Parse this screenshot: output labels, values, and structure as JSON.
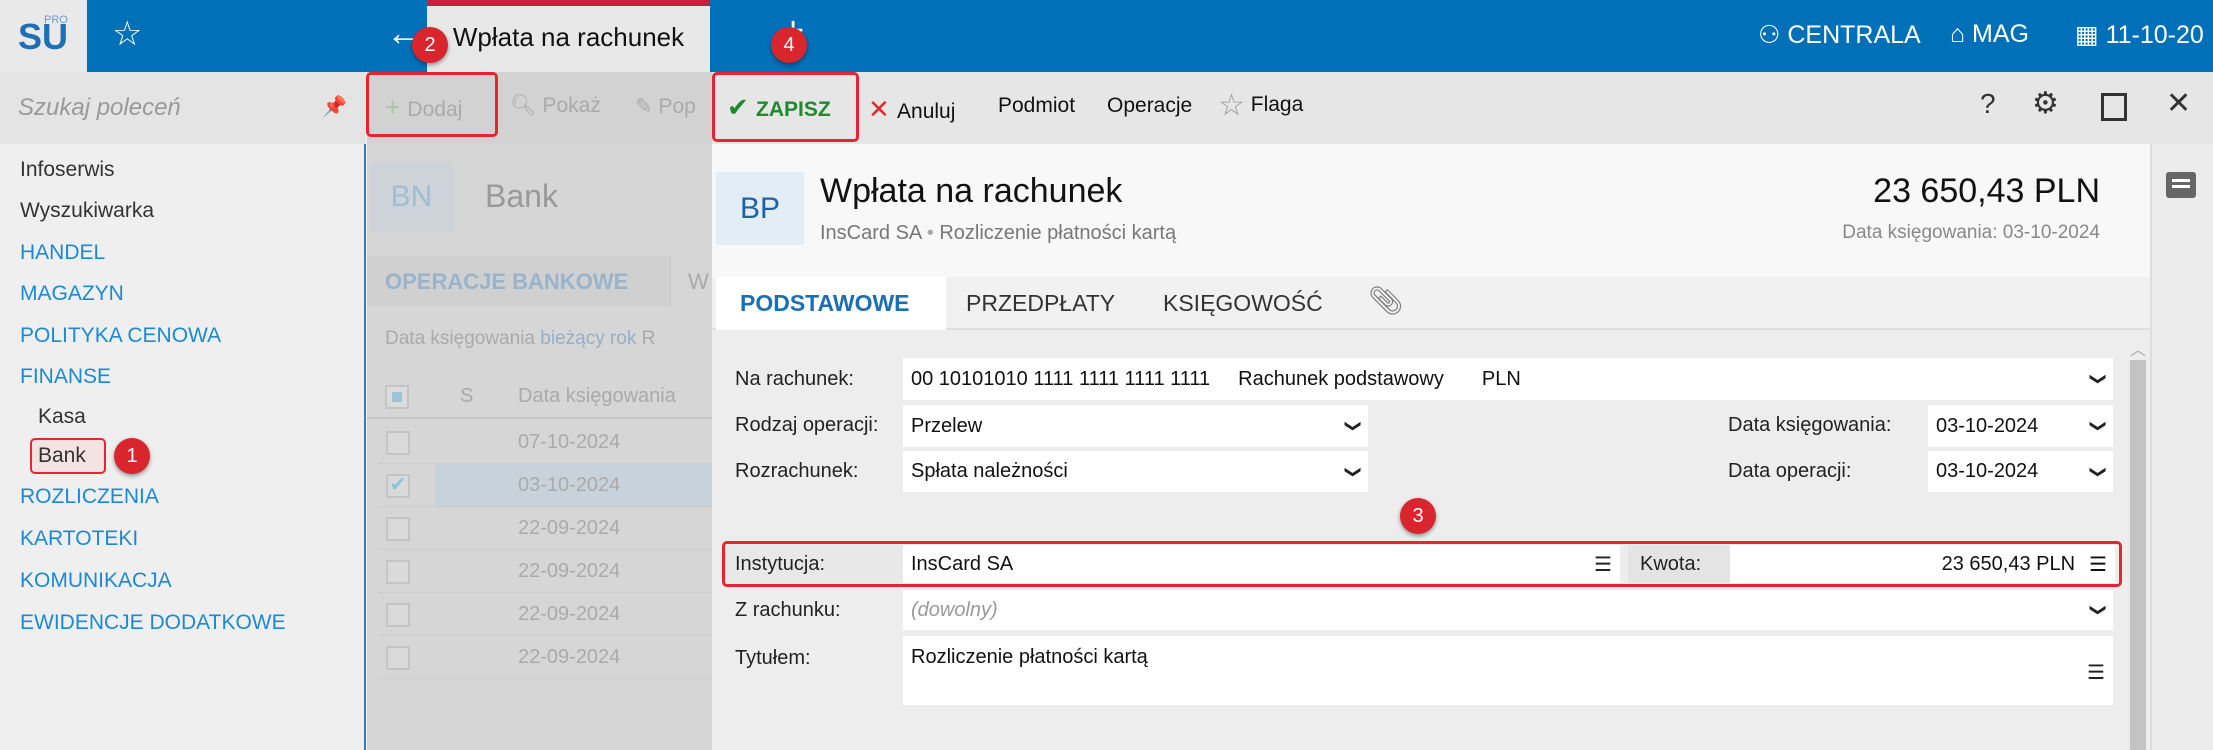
{
  "header": {
    "logo": "SU",
    "logo_sup": "PRO",
    "tab_title": "Wpłata na rachunek",
    "branch": "CENTRALA",
    "warehouse": "MAG",
    "date": "11-10-20"
  },
  "sidebar": {
    "search_placeholder": "Szukaj poleceń",
    "items": [
      "Infoserwis",
      "Wyszukiwarka",
      "HANDEL",
      "MAGAZYN",
      "POLITYKA CENOWA",
      "FINANSE",
      "Kasa",
      "Bank",
      "ROZLICZENIA",
      "KARTOTEKI",
      "KOMUNIKACJA",
      "EWIDENCJE DODATKOWE"
    ]
  },
  "middle": {
    "toolbar": [
      "Dodaj",
      "Pokaż",
      "Pop"
    ],
    "badge": "BN",
    "title": "Bank",
    "tab": "OPERACJE BANKOWE",
    "tab2": "W",
    "filter_label": "Data księgowania",
    "filter_value": "bieżący rok",
    "filter_more": "R",
    "col_s": "S",
    "col_date": "Data księgowania",
    "rows": [
      "07-10-2024",
      "03-10-2024",
      "22-09-2024",
      "22-09-2024",
      "22-09-2024",
      "22-09-2024"
    ]
  },
  "dialog": {
    "toolbar": {
      "save": "ZAPISZ",
      "cancel": "Anuluj",
      "subject": "Podmiot",
      "operations": "Operacje",
      "flag": "Flaga"
    },
    "badge": "BP",
    "title": "Wpłata na rachunek",
    "subject": "InsCard SA",
    "sep": "•",
    "subtitle": "Rozliczenie płatności kartą",
    "amount": "23 650,43 PLN",
    "posting_date_text": "Data księgowania: 03-10-2024",
    "tabs": [
      "PODSTAWOWE",
      "PRZEDPŁATY",
      "KSIĘGOWOŚĆ"
    ],
    "form": {
      "account_label": "Na rachunek:",
      "account_number": "00 10101010 1111 1111 1111 1111",
      "account_name": "Rachunek podstawowy",
      "account_currency": "PLN",
      "op_type_label": "Rodzaj operacji:",
      "op_type": "Przelew",
      "settlement_label": "Rozrachunek:",
      "settlement": "Spłata należności",
      "posting_date_label": "Data księgowania:",
      "posting_date": "03-10-2024",
      "op_date_label": "Data operacji:",
      "op_date": "03-10-2024",
      "institution_label": "Instytucja:",
      "institution": "InsCard SA",
      "amount_label": "Kwota:",
      "amount": "23 650,43 PLN",
      "from_account_label": "Z rachunku:",
      "from_account_placeholder": "(dowolny)",
      "title_label": "Tytułem:",
      "title": "Rozliczenie płatności kartą"
    }
  },
  "annotations": [
    "1",
    "2",
    "3",
    "4"
  ],
  "colors": {
    "brand": "#0070b8",
    "accent": "#1a8ad4",
    "highlight": "#e6262e"
  }
}
